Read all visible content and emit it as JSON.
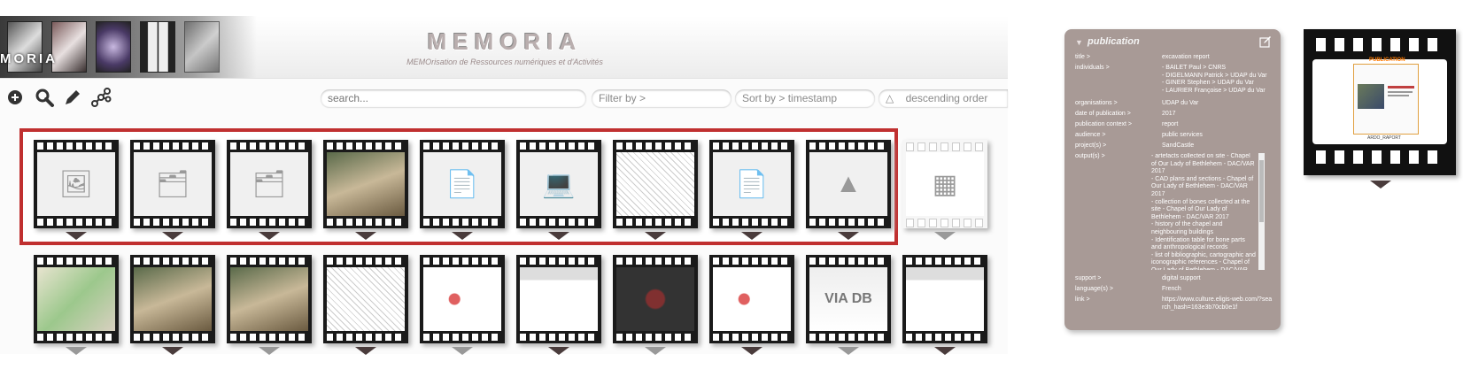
{
  "header": {
    "logo_text": "MORIA",
    "title": "MEMORIA",
    "subtitle": "MEMOrisation de Ressources numériques et d'Activités"
  },
  "toolbar": {
    "icons": [
      "add-icon",
      "search-icon",
      "edit-icon",
      "graph-icon"
    ],
    "search_placeholder": "search...",
    "filter_label": "Filter by >",
    "sort_label": "Sort by  > timestamp",
    "order_label": "descending order",
    "order_symbol": "△"
  },
  "grid": {
    "row1": [
      {
        "kind": "images",
        "glyph": "🖼"
      },
      {
        "kind": "documents",
        "glyph": "🗂"
      },
      {
        "kind": "documents",
        "glyph": "🗂"
      },
      {
        "kind": "photo",
        "glyph": ""
      },
      {
        "kind": "text-document",
        "glyph": "📄"
      },
      {
        "kind": "laptop",
        "glyph": "💻"
      },
      {
        "kind": "plan",
        "glyph": ""
      },
      {
        "kind": "text-document",
        "glyph": "📄"
      },
      {
        "kind": "3d-model",
        "glyph": "▲"
      },
      {
        "kind": "database",
        "glyph": "▦"
      }
    ],
    "row2": [
      {
        "kind": "map"
      },
      {
        "kind": "photo"
      },
      {
        "kind": "photo"
      },
      {
        "kind": "plan"
      },
      {
        "kind": "diagram"
      },
      {
        "kind": "screenshot"
      },
      {
        "kind": "dark-plan"
      },
      {
        "kind": "diagram"
      },
      {
        "kind": "database",
        "label": "VIA DB"
      },
      {
        "kind": "screenshot"
      }
    ]
  },
  "detail": {
    "title": "publication",
    "fields": [
      {
        "label": "title >",
        "value": "excavation report"
      },
      {
        "label": "individuals >",
        "value": "- BAILET Paul > CNRS\n- DIGELMANN Patrick > UDAP du Var\n- GINER Stephen > UDAP du Var\n- LAURIER Françoise > UDAP du Var"
      },
      {
        "label": "organisations >",
        "value": "UDAP du Var"
      },
      {
        "label": "date of publication >",
        "value": "2017"
      },
      {
        "label": "publication context >",
        "value": "report"
      },
      {
        "label": "audience >",
        "value": "public services"
      },
      {
        "label": "project(s) >",
        "value": "SandCastle"
      },
      {
        "label": "output(s) >",
        "value": "- artefacts collected on site - Chapel of Our Lady of Bethlehem - DAC/VAR 2017\n- CAD plans and sections - Chapel of Our Lady of Bethlehem - DAC/VAR 2017\n- collection of bones collected at the site - Chapel of Our Lady of Bethlehem - DAC/VAR 2017\n- history of the chapel and neighbouring buildings\n- Identification table for bone parts and anthropological records\n- list of bibliographic, cartographic and iconographic references - Chapel of Our Lady of Bethlehem - DAC/VAR"
      },
      {
        "label": "support >",
        "value": "digital support"
      },
      {
        "label": "language(s) >",
        "value": "French"
      },
      {
        "label": "link >",
        "value": "https://www.culture.eligis-web.com/?search_hash=163e3b70cb0e1f"
      }
    ]
  },
  "preview": {
    "badge": "PUBLICATION",
    "caption": "ARDO_RAPORT",
    "colors": {
      "badge": "#ff7a00"
    }
  },
  "colors": {
    "selection": "#c03030",
    "panel": "#a89a96",
    "caret": "#4a3c3c"
  }
}
